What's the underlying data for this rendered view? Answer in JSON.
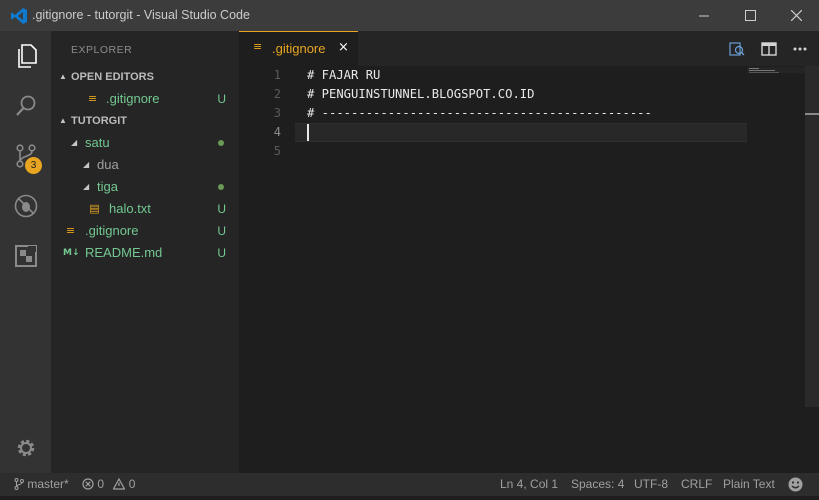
{
  "window": {
    "title": ".gitignore - tutorgit - Visual Studio Code",
    "accent": "#e8a521",
    "title_bar_color": "#3c3c3c"
  },
  "activity_bar": {
    "items": [
      "files-icon",
      "search-icon",
      "source-control-icon",
      "debug-icon",
      "extensions-icon"
    ],
    "source_control_badge": "3",
    "bottom_icon": "settings-gear-icon"
  },
  "sidebar": {
    "header": "EXPLORER",
    "open_editors_label": "OPEN EDITORS",
    "open_editors": [
      {
        "name": ".gitignore",
        "status": "U"
      }
    ],
    "folder_label": "TUTORGIT",
    "tree": [
      {
        "name": "satu",
        "type": "folder",
        "status": "dot"
      },
      {
        "name": "dua",
        "type": "folder",
        "status": ""
      },
      {
        "name": "tiga",
        "type": "folder",
        "status": "dot"
      },
      {
        "name": "halo.txt",
        "type": "file",
        "status": "U"
      },
      {
        "name": ".gitignore",
        "type": "file",
        "status": "U"
      },
      {
        "name": "README.md",
        "type": "file",
        "status": "U"
      }
    ]
  },
  "tabs": [
    {
      "label": ".gitignore",
      "close": "×",
      "icon": "gitignore-file-icon"
    }
  ],
  "editor": {
    "lines": [
      {
        "number": "1",
        "text": "# FAJAR RU"
      },
      {
        "number": "2",
        "text": "# PENGUINSTUNNEL.BLOGSPOT.CO.ID"
      },
      {
        "number": "3",
        "text": "# ---------------------------------------------"
      },
      {
        "number": "4",
        "text": ""
      },
      {
        "number": "5",
        "text": ""
      }
    ],
    "cursor_line": 4
  },
  "status_bar": {
    "branch": "master*",
    "errors": "0",
    "warnings": "0",
    "position": "Ln 4, Col 1",
    "spaces": "Spaces: 4",
    "encoding": "UTF-8",
    "eol": "CRLF",
    "language": "Plain Text"
  }
}
